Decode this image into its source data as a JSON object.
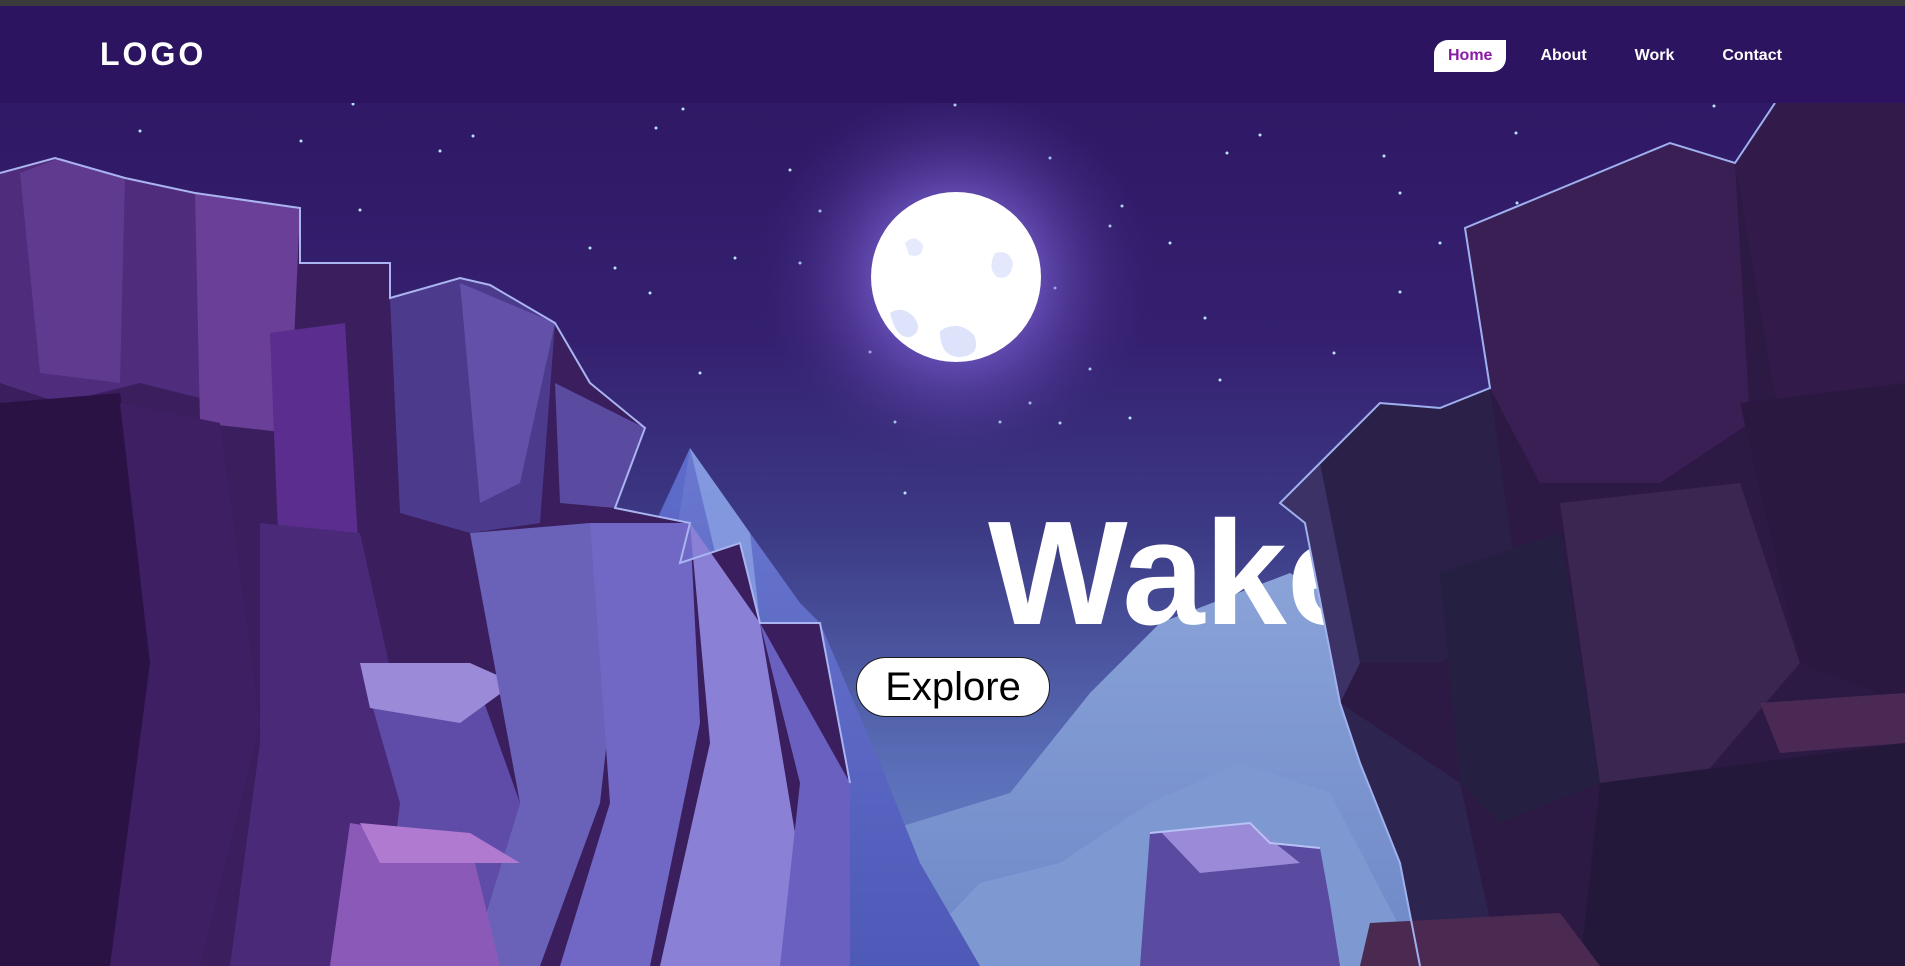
{
  "header": {
    "logo_text": "LOGO",
    "nav": [
      {
        "label": "Home",
        "active": true
      },
      {
        "label": "About",
        "active": false
      },
      {
        "label": "Work",
        "active": false
      },
      {
        "label": "Contact",
        "active": false
      }
    ]
  },
  "hero": {
    "title": "Wake",
    "explore_label": "Explore"
  },
  "colors": {
    "header_bg": "#2c1460",
    "active_nav_text": "#8a1aa6",
    "sky_top": "#2d1661",
    "sky_bottom": "#6e88c8",
    "moon": "#ffffff"
  }
}
